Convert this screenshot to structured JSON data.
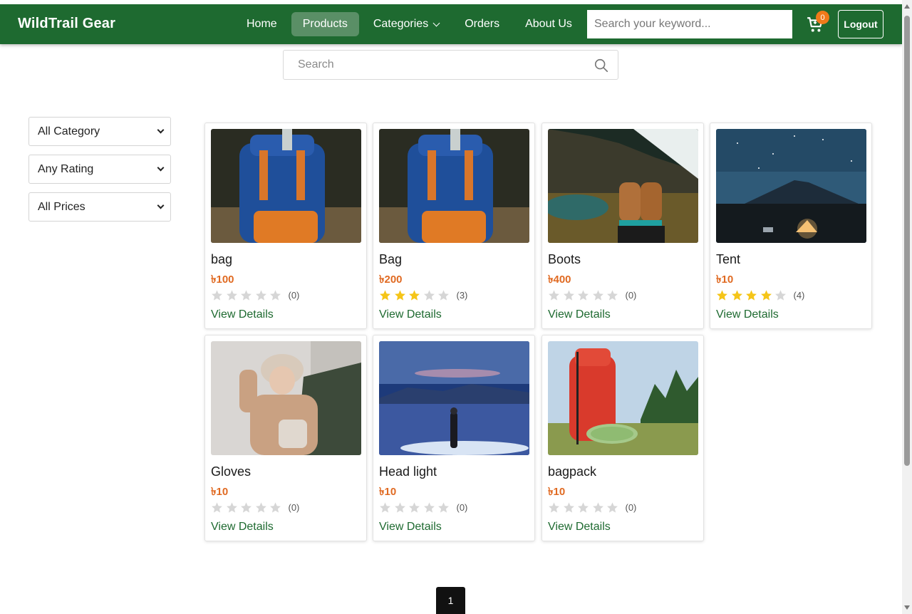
{
  "navbar": {
    "brand": "WildTrail Gear",
    "links": [
      {
        "label": "Home",
        "active": false
      },
      {
        "label": "Products",
        "active": true
      },
      {
        "label": "Categories",
        "active": false,
        "dropdown": true
      },
      {
        "label": "Orders",
        "active": false
      },
      {
        "label": "About Us",
        "active": false
      }
    ],
    "search_placeholder": "Search your keyword...",
    "cart_count": "0",
    "logout_label": "Logout"
  },
  "search": {
    "placeholder": "Search"
  },
  "filters": {
    "category": "All Category",
    "rating": "Any Rating",
    "price": "All Prices"
  },
  "products": [
    {
      "title": "bag",
      "price": "৳100",
      "rating": 0,
      "reviews": "(0)",
      "details": "View Details",
      "image": "blue-backpack"
    },
    {
      "title": "Bag",
      "price": "৳200",
      "rating": 3,
      "reviews": "(3)",
      "details": "View Details",
      "image": "blue-backpack"
    },
    {
      "title": "Boots",
      "price": "৳400",
      "rating": 0,
      "reviews": "(0)",
      "details": "View Details",
      "image": "hiking-boots"
    },
    {
      "title": "Tent",
      "price": "৳10",
      "rating": 4,
      "reviews": "(4)",
      "details": "View Details",
      "image": "tent-night"
    },
    {
      "title": "Gloves",
      "price": "৳10",
      "rating": 0,
      "reviews": "(0)",
      "details": "View Details",
      "image": "winter-woman"
    },
    {
      "title": "Head light",
      "price": "৳10",
      "rating": 0,
      "reviews": "(0)",
      "details": "View Details",
      "image": "night-hiker"
    },
    {
      "title": "bagpack",
      "price": "৳10",
      "rating": 0,
      "reviews": "(0)",
      "details": "View Details",
      "image": "red-backpack"
    }
  ],
  "pagination": {
    "current": "1"
  },
  "colors": {
    "brand_green": "#1e6a30",
    "price_orange": "#e06a22",
    "star_gold": "#f5c518",
    "star_empty": "#d6d6d6"
  }
}
